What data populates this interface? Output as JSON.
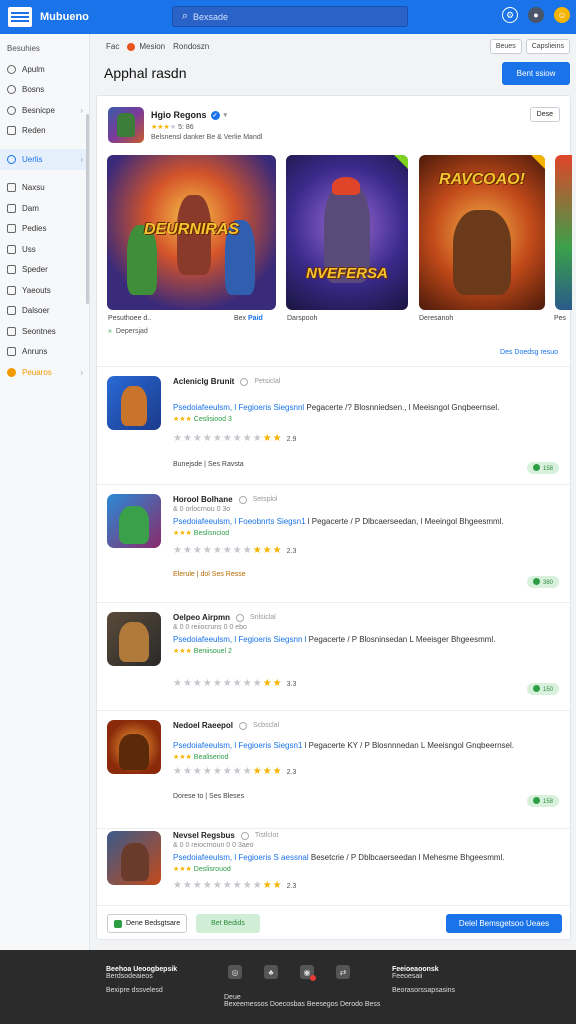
{
  "header": {
    "brand": "Mubueno",
    "search_placeholder": "Bexsade",
    "colors": {
      "bar": "#1a73e8",
      "accent": "#f29900"
    }
  },
  "sidebar": {
    "heading": "Besuhies",
    "items": [
      {
        "label": "Apulm",
        "icon": "circle-icon"
      },
      {
        "label": "Bosns",
        "icon": "circle-icon"
      },
      {
        "label": "Besnicpe",
        "icon": "search-icon",
        "chevron": true
      },
      {
        "label": "Reden",
        "icon": "box-icon"
      },
      {
        "label": "Uerlis",
        "icon": "drop-icon",
        "active": true,
        "chevron": true
      },
      {
        "label": "Naxsu",
        "icon": "box-icon"
      },
      {
        "label": "Dam",
        "icon": "box-icon"
      },
      {
        "label": "Pedies",
        "icon": "box-icon"
      },
      {
        "label": "Uss",
        "icon": "box-icon"
      },
      {
        "label": "Speder",
        "icon": "box-icon"
      },
      {
        "label": "Yaeouts",
        "icon": "box-icon"
      },
      {
        "label": "Dalsoer",
        "icon": "box-icon"
      },
      {
        "label": "Seontnes",
        "icon": "box-icon"
      },
      {
        "label": "Anruns",
        "icon": "box-icon"
      },
      {
        "label": "Peuaros",
        "icon": "star-icon",
        "orange": true,
        "chevron": true
      }
    ]
  },
  "crumbs": [
    "Fac",
    "Mesion",
    "Rondoszn"
  ],
  "header_buttons": [
    "Beues",
    "Capslieins"
  ],
  "page_title": "Apphal rasdn",
  "top_button": "Bent ssiow",
  "featured": {
    "name": "Hgio Regons",
    "rating_text": "5: 86",
    "desc": "Belsnensl danker Be & Verlie Mandl",
    "more": "Dese",
    "shots": [
      {
        "title": "DEURNIRAS",
        "caption": "Pesuthoee d..",
        "caption_right": "Bex",
        "caption_tag": "Paid"
      },
      {
        "title": "NVEFERSA",
        "caption": "Darspooh"
      },
      {
        "title": "RAVCOAO!",
        "caption": "Deresanoh"
      },
      {
        "title": "",
        "caption": "Pes"
      }
    ],
    "meta": "Depersjad",
    "link": "Des Doedsg resuo"
  },
  "apps": [
    {
      "name": "Acleniclg Brunit",
      "sub": "Petsiclal",
      "subline": "",
      "desc_hl": "Psedoiafeeulsm, l Fegioeris Siegsnnl",
      "desc_rest": "Pegacerte /? Blosnniedsen., l Meeisngol Gnqbeernsel.",
      "category": "Ceslisiood 3",
      "rating": "2.9",
      "stars_on": 2,
      "footer": "Bunejsde | Ses Ravsta",
      "badge": "158"
    },
    {
      "name": "Horool Bolhane",
      "sub": "Setsplol",
      "subline": "& 0 orlocrnou 0 3o",
      "desc_hl": "Psedoiafeeulsm, l Foeobnrts Siegsn1",
      "desc_rest": "l Pegacerte / P Dlbcaerseedan, l Meeingol Bhgeesmml.",
      "category": "Beslisnciod",
      "rating": "2.3",
      "stars_on": 3,
      "footer": "Elerule | dol Ses Resse",
      "badge": "380"
    },
    {
      "name": "Oelpeo Airpmn",
      "sub": "Snlsiclal",
      "subline": "& 0 0 reiiocruns 0 0 ebo",
      "desc_hl": "Psedoiafeeulsm, l Fegioeris Siegsnn l",
      "desc_rest": "Pegacerte / P Blosninsedan L Meeisger Bhgeesmml.",
      "category": "Beniisouel 2",
      "rating": "3.3",
      "stars_on": 2,
      "footer": "",
      "badge": "150"
    },
    {
      "name": "Nedoel Raeepol",
      "sub": "Scbsclal",
      "subline": "",
      "desc_hl": "Psedoiafeeulsm, l Fegioeris Siegsn1",
      "desc_rest": "l Pegacerte KY / P Blosnnnedan L Meeisngol Gnqbeernsel.",
      "category": "Bealiseriod",
      "rating": "2.3",
      "stars_on": 3,
      "footer": "Dorese to | Ses Bleses",
      "badge": "158"
    },
    {
      "name": "Nevsel Regsbus",
      "sub": "Tistlclot",
      "subline": "& 0 0 reiocrnoun 0 0 3aeo",
      "desc_hl": "Psedoiafeeulsm, l Fegioeris S aessnal",
      "desc_rest": "Besetcrie / P Dblbcaerseedan l Mehesme Bhgeesmml.",
      "category": "Deslisrouod",
      "rating": "2.3",
      "stars_on": 3,
      "footer": "",
      "badge": ""
    }
  ],
  "card_footer": {
    "left": "Dene Bedsgtsare",
    "green": "Bet Bedids",
    "primary": "Delel Bemsgetsoo Ueaes"
  },
  "footer": {
    "col1_title": "Beehoa Ueoogbepsik",
    "col1_line": "Berdsodeaieos",
    "col1_line2": "Bexipre dssvelesd",
    "mid_line1": "Deue",
    "mid_line2": "Bexeemessos Doecosbas Beesegos Derodo Bess",
    "col3_title": "Feeioeaoonsk",
    "col3_line": "Feeoesaii",
    "col3_line2": "Beorasorssapsasins"
  }
}
